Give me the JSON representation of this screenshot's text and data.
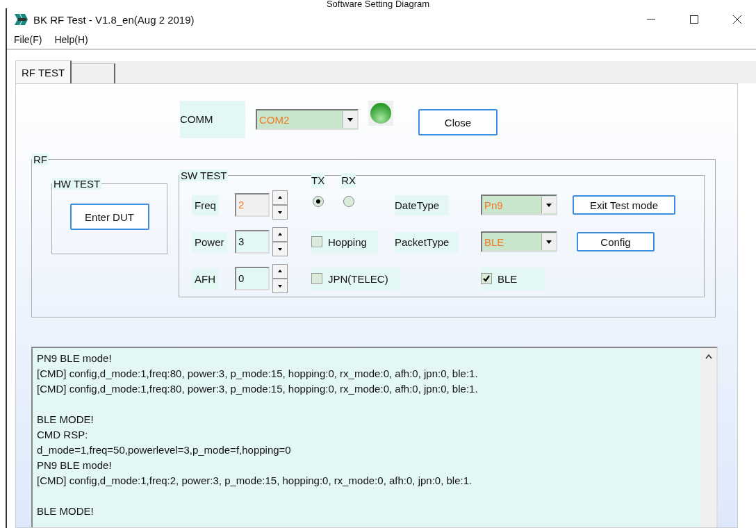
{
  "caption": "Software Setting Diagram",
  "window": {
    "title": "BK RF Test - V1.8_en(Aug  2 2019)"
  },
  "menu": [
    "File(F)",
    "Help(H)"
  ],
  "tabs": [
    {
      "label": "RF TEST",
      "selected": true
    },
    {
      "selected": false
    }
  ],
  "comm": {
    "label": "COMM",
    "port": "COM2",
    "connected": true,
    "button": "Close"
  },
  "rf": {
    "title": "RF",
    "hw_test": {
      "title": "HW TEST",
      "button": "Enter DUT"
    },
    "sw_test": {
      "title": "SW TEST",
      "spinners": [
        {
          "label": "Freq",
          "value": "2",
          "disabled": true
        },
        {
          "label": "Power",
          "value": "3",
          "disabled": false
        },
        {
          "label": "AFH",
          "value": "0",
          "disabled": false
        }
      ],
      "modes": [
        {
          "label": "TX",
          "selected": true
        },
        {
          "label": "RX",
          "selected": false
        }
      ],
      "options": [
        {
          "label": "Hopping",
          "checked": false
        },
        {
          "label": "JPN(TELEC)",
          "checked": false
        }
      ],
      "combos": [
        {
          "label": "DateType",
          "value": "Pn9"
        },
        {
          "label": "PacketType",
          "value": "BLE"
        }
      ],
      "buttons": [
        "Exit Test mode",
        "Config"
      ],
      "ble": {
        "label": "BLE",
        "checked": true
      }
    }
  },
  "log": [
    [
      "PN9 BLE mode!",
      "[CMD] config,d_mode:1,freq:80, power:3, p_mode:15, hopping:0, rx_mode:0, afh:0, jpn:0, ble:1.",
      "[CMD] config,d_mode:1,freq:80, power:3, p_mode:15, hopping:0, rx_mode:0, afh:0, jpn:0, ble:1."
    ],
    [
      "BLE MODE!",
      "CMD RSP:",
      "d_mode=1,freq=50,powerlevel=3,p_mode=f,hopping=0",
      "PN9 BLE mode!",
      "[CMD] config,d_mode:1,freq:2, power:3, p_mode:15, hopping:0, rx_mode:0, afh:0, jpn:0, ble:1."
    ],
    [
      "BLE MODE!"
    ]
  ]
}
